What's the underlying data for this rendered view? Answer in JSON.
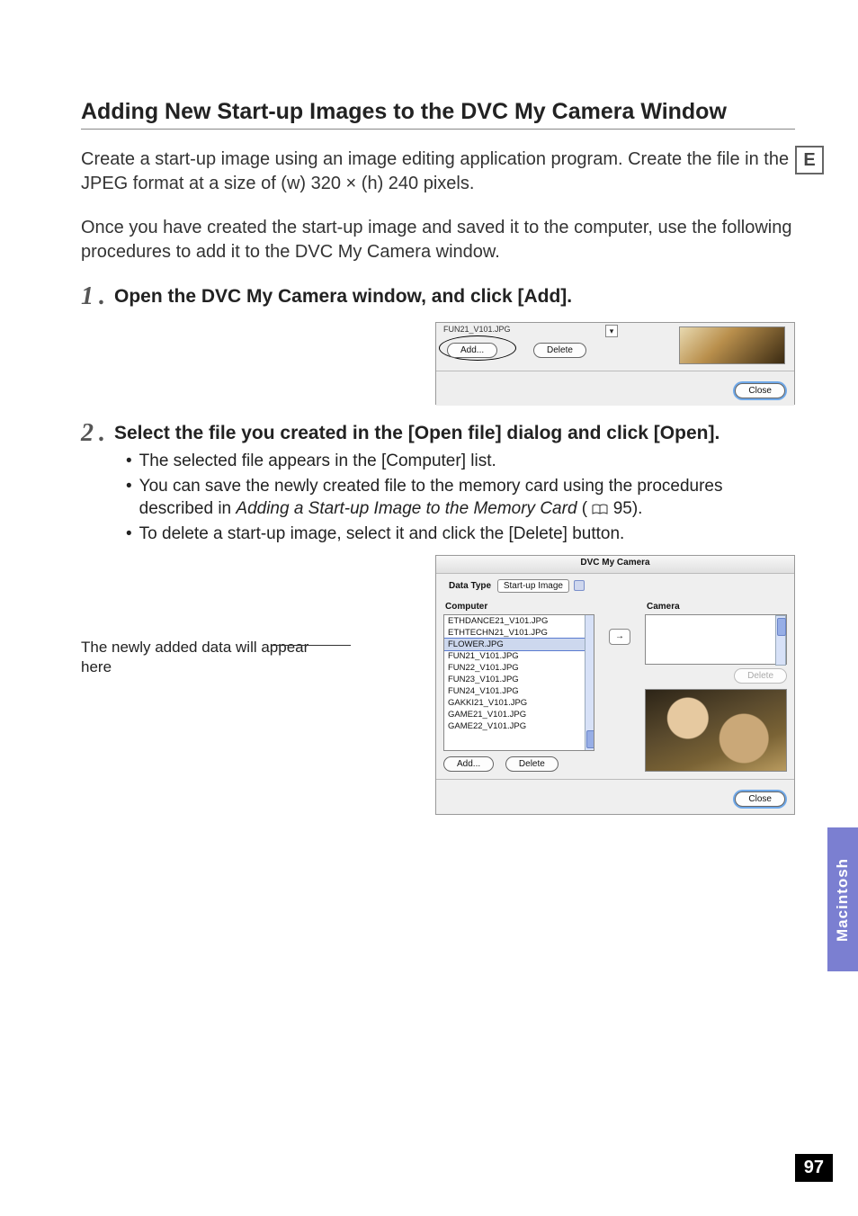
{
  "badge": {
    "letter": "E"
  },
  "heading": "Adding New Start-up Images to the DVC My Camera Window",
  "intro1": "Create a start-up image using an image editing application program. Create the file in the JPEG format at a size of (w) 320 × (h) 240 pixels.",
  "intro2": "Once you have created the start-up image and saved it to the computer, use the following procedures to add it to the DVC My Camera window.",
  "steps": {
    "s1": {
      "num": "1",
      "dot": ".",
      "text": "Open the DVC My Camera window, and click [Add]."
    },
    "s2": {
      "num": "2",
      "dot": ".",
      "text": "Select the file you created in the [Open file] dialog and click [Open]."
    }
  },
  "bullets": {
    "b1": "The selected file appears in the [Computer] list.",
    "b2a": "You can save the newly created file to the memory card using the procedures described in ",
    "b2i": "Adding a Start-up Image to the Memory Card",
    "b2c": " ( ",
    "b2p": " 95).",
    "b3": "To delete a start-up image, select it and click the [Delete] button."
  },
  "shot1": {
    "truncated": "FUN21_V101.JPG",
    "add": "Add...",
    "delete": "Delete",
    "close": "Close"
  },
  "annotation": "The newly added data will appear here",
  "shot2": {
    "title": "DVC My Camera",
    "dataTypeLabel": "Data Type",
    "dataTypeValue": "Start-up Image",
    "computerLabel": "Computer",
    "cameraLabel": "Camera",
    "arrow": "→",
    "items": [
      "ETHDANCE21_V101.JPG",
      "ETHTECHN21_V101.JPG",
      "FLOWER.JPG",
      "FUN21_V101.JPG",
      "FUN22_V101.JPG",
      "FUN23_V101.JPG",
      "FUN24_V101.JPG",
      "GAKKI21_V101.JPG",
      "GAME21_V101.JPG",
      "GAME22_V101.JPG"
    ],
    "selectedIndex": 2,
    "add": "Add...",
    "delete": "Delete",
    "deleteGhost": "Delete",
    "close": "Close"
  },
  "sideTab": "Macintosh",
  "pageNumber": "97"
}
